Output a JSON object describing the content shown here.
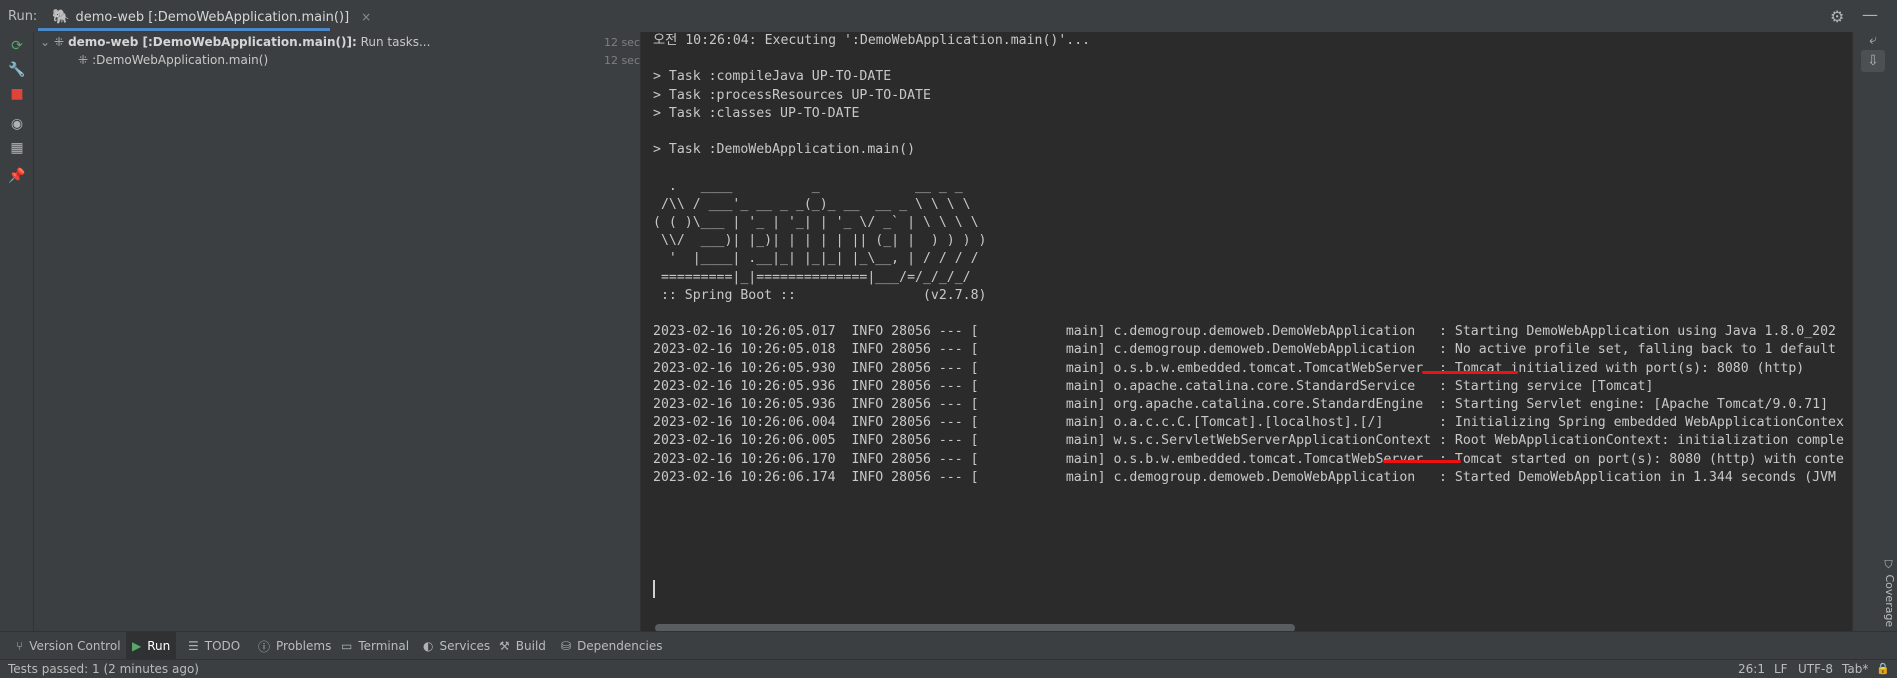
{
  "runbar": {
    "label": "Run:",
    "tab_label": "demo-web [:DemoWebApplication.main()]",
    "tab_close": "×",
    "gear_icon": "⚙",
    "minimize_icon": "—"
  },
  "left_toolbar": {
    "icons": [
      {
        "name": "rerun-icon",
        "glyph": "⟳",
        "color": "#59a869"
      },
      {
        "name": "wrench-icon",
        "glyph": "🔧",
        "color": "#afb1b3"
      },
      {
        "name": "stop-icon",
        "glyph": "■",
        "color": "#e0433a"
      },
      {
        "name": "eye-icon",
        "glyph": "◉",
        "color": "#afb1b3"
      },
      {
        "name": "layout-icon",
        "glyph": "▦",
        "color": "#afb1b3"
      },
      {
        "name": "pin-icon",
        "glyph": "📌",
        "color": "#afb1b3"
      }
    ]
  },
  "tree": {
    "rows": [
      {
        "indent": 0,
        "bold_label": "demo-web [:DemoWebApplication.main()]:",
        "label": " Run tasks...",
        "time": "12 sec"
      },
      {
        "indent": 1,
        "bold_label": "",
        "label": ":DemoWebApplication.main()",
        "time": "12 sec"
      }
    ]
  },
  "console": {
    "lines": [
      "오전 10:26:04: Executing ':DemoWebApplication.main()'...",
      "",
      "> Task :compileJava UP-TO-DATE",
      "> Task :processResources UP-TO-DATE",
      "> Task :classes UP-TO-DATE",
      "",
      "> Task :DemoWebApplication.main()",
      "",
      "  .   ____          _            __ _ _",
      " /\\\\ / ___'_ __ _ _(_)_ __  __ _ \\ \\ \\ \\",
      "( ( )\\___ | '_ | '_| | '_ \\/ _` | \\ \\ \\ \\",
      " \\\\/  ___)| |_)| | | | | || (_| |  ) ) ) )",
      "  '  |____| .__|_| |_|_| |_\\__, | / / / /",
      " =========|_|==============|___/=/_/_/_/",
      " :: Spring Boot ::                (v2.7.8)",
      "",
      "2023-02-16 10:26:05.017  INFO 28056 --- [           main] c.demogroup.demoweb.DemoWebApplication   : Starting DemoWebApplication using Java 1.8.0_202",
      "2023-02-16 10:26:05.018  INFO 28056 --- [           main] c.demogroup.demoweb.DemoWebApplication   : No active profile set, falling back to 1 default",
      "2023-02-16 10:26:05.930  INFO 28056 --- [           main] o.s.b.w.embedded.tomcat.TomcatWebServer  : Tomcat initialized with port(s): 8080 (http)",
      "2023-02-16 10:26:05.936  INFO 28056 --- [           main] o.apache.catalina.core.StandardService   : Starting service [Tomcat]",
      "2023-02-16 10:26:05.936  INFO 28056 --- [           main] org.apache.catalina.core.StandardEngine  : Starting Servlet engine: [Apache Tomcat/9.0.71]",
      "2023-02-16 10:26:06.004  INFO 28056 --- [           main] o.a.c.c.C.[Tomcat].[localhost].[/]       : Initializing Spring embedded WebApplicationContex",
      "2023-02-16 10:26:06.005  INFO 28056 --- [           main] w.s.c.ServletWebServerApplicationContext : Root WebApplicationContext: initialization comple",
      "2023-02-16 10:26:06.170  INFO 28056 --- [           main] o.s.b.w.embedded.tomcat.TomcatWebServer  : Tomcat started on port(s): 8080 (http) with conte",
      "2023-02-16 10:26:06.174  INFO 28056 --- [           main] c.demogroup.demoweb.DemoWebApplication   : Started DemoWebApplication in 1.344 seconds (JVM"
    ]
  },
  "right_toolbar": {
    "icons": [
      {
        "name": "soft-wrap-icon",
        "glyph": "⤶"
      },
      {
        "name": "scroll-to-end-icon",
        "glyph": "⇩"
      }
    ],
    "coverage_label": "Coverage"
  },
  "bottombar": {
    "tabs": [
      {
        "name": "tab-version-control",
        "icon": "⑂",
        "label": "Version Control",
        "active": false
      },
      {
        "name": "tab-run",
        "icon": "▶",
        "label": "Run",
        "active": true
      },
      {
        "name": "tab-todo",
        "icon": "☰",
        "label": "TODO",
        "active": false
      },
      {
        "name": "tab-problems",
        "icon": "ⓘ",
        "label": "Problems",
        "active": false
      },
      {
        "name": "tab-terminal",
        "icon": "▭",
        "label": "Terminal",
        "active": false
      },
      {
        "name": "tab-services",
        "icon": "◐",
        "label": "Services",
        "active": false
      },
      {
        "name": "tab-build",
        "icon": "⚒",
        "label": "Build",
        "active": false
      },
      {
        "name": "tab-dependencies",
        "icon": "⛁",
        "label": "Dependencies",
        "active": false
      }
    ]
  },
  "statusbar": {
    "text": "Tests passed: 1 (2 minutes ago)",
    "position": "26:1",
    "line_sep": "LF",
    "encoding": "UTF-8",
    "indent": "Tab*",
    "lock_icon": "🔒"
  },
  "colors": {
    "accent": "#4a88c7",
    "annotation_red": "#e11111"
  }
}
